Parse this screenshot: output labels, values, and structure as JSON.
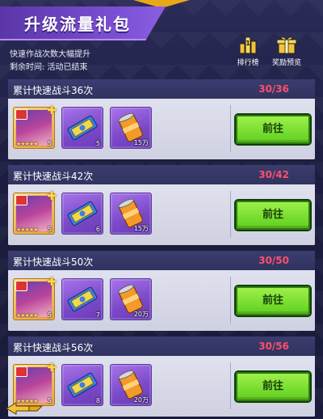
{
  "header": {
    "title": "升级流量礼包",
    "description": "快速作战次数大幅提升",
    "remaining_time": "剩余时间: 活动已结束",
    "ranking_label": "排行榜",
    "reward_preview_label": "奖励预览"
  },
  "tasks": [
    {
      "title": "累计快速战斗36次",
      "progress": "30/36",
      "hero_stars": "★★★★★",
      "hero_count": "5",
      "ticket_count": "5",
      "coin_count": "15万",
      "button_label": "前往"
    },
    {
      "title": "累计快速战斗42次",
      "progress": "30/42",
      "hero_stars": "★★★★★",
      "hero_count": "5",
      "ticket_count": "6",
      "coin_count": "15万",
      "button_label": "前往"
    },
    {
      "title": "累计快速战斗50次",
      "progress": "30/50",
      "hero_stars": "★★★★★",
      "hero_count": "5",
      "ticket_count": "7",
      "coin_count": "20万",
      "button_label": "前往"
    },
    {
      "title": "累计快速战斗56次",
      "progress": "30/56",
      "hero_stars": "★★★★★",
      "hero_count": "5",
      "ticket_count": "8",
      "coin_count": "20万",
      "button_label": "前往"
    }
  ],
  "colors": {
    "progress": "#ff4f6a",
    "go_button": "#7ee03a",
    "title_banner": "#7b4fd3"
  }
}
